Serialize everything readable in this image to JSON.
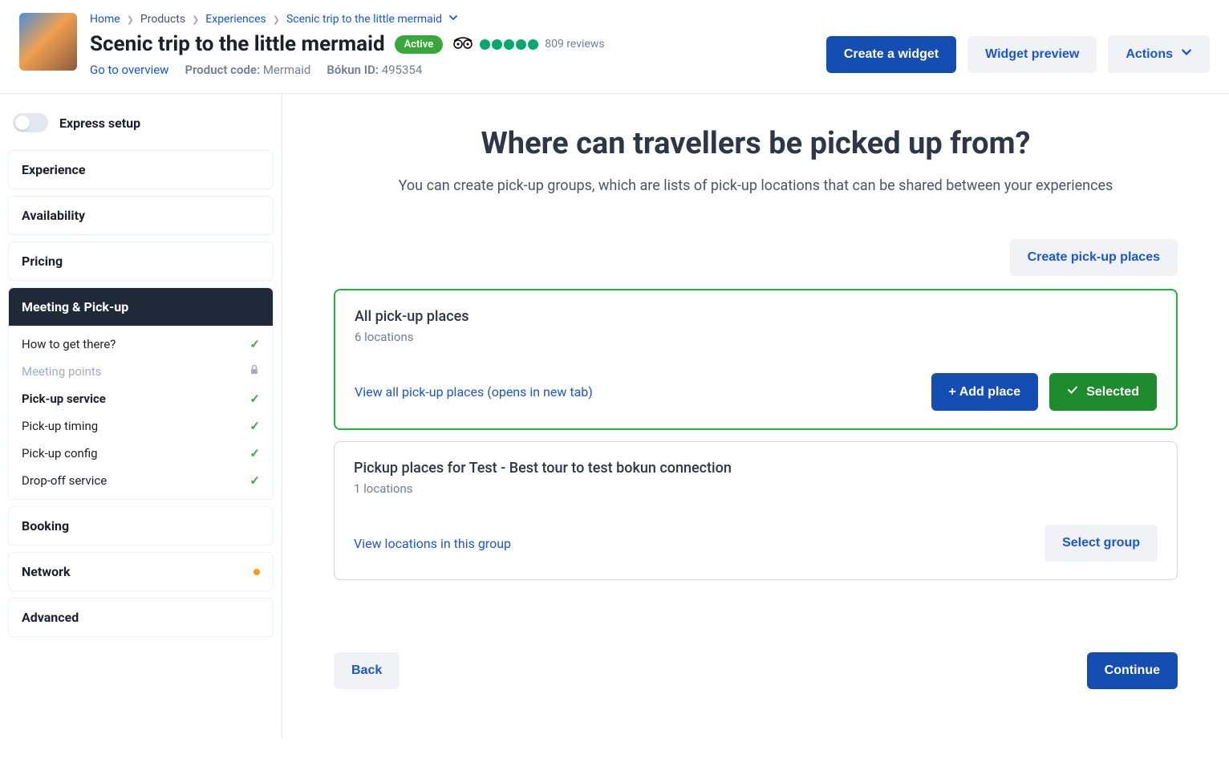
{
  "breadcrumb": {
    "home": "Home",
    "products": "Products",
    "experiences": "Experiences",
    "current": "Scenic trip to the little mermaid"
  },
  "product": {
    "title": "Scenic trip to the little mermaid",
    "status_badge": "Active",
    "reviews_text": "809 reviews",
    "overview_link": "Go to overview",
    "code_label": "Product code:",
    "code_value": "Mermaid",
    "bokun_label": "Bókun ID:",
    "bokun_value": "495354"
  },
  "header_actions": {
    "create_widget": "Create a widget",
    "widget_preview": "Widget preview",
    "actions": "Actions"
  },
  "sidebar": {
    "express_label": "Express setup",
    "sections": {
      "experience": "Experience",
      "availability": "Availability",
      "pricing": "Pricing",
      "meeting": "Meeting & Pick-up",
      "booking": "Booking",
      "network": "Network",
      "advanced": "Advanced"
    },
    "meeting_items": {
      "how_to_get": "How to get there?",
      "meeting_points": "Meeting points",
      "pickup_service": "Pick-up service",
      "pickup_timing": "Pick-up timing",
      "pickup_config": "Pick-up config",
      "dropoff": "Drop-off service"
    }
  },
  "main": {
    "heading": "Where can travellers be picked up from?",
    "subheading": "You can create pick-up groups, which are lists of pick-up locations that can be shared between your experiences",
    "create_places_btn": "Create pick-up places",
    "groups": [
      {
        "title": "All pick-up places",
        "sub": "6 locations",
        "view_link": "View all pick-up places (opens in new tab)",
        "add_place": "+ Add place",
        "selected_btn": "Selected"
      },
      {
        "title": "Pickup places for Test - Best tour to test bokun connection",
        "sub": "1 locations",
        "view_link": "View locations in this group",
        "select_btn": "Select group"
      }
    ],
    "back": "Back",
    "continue": "Continue"
  }
}
